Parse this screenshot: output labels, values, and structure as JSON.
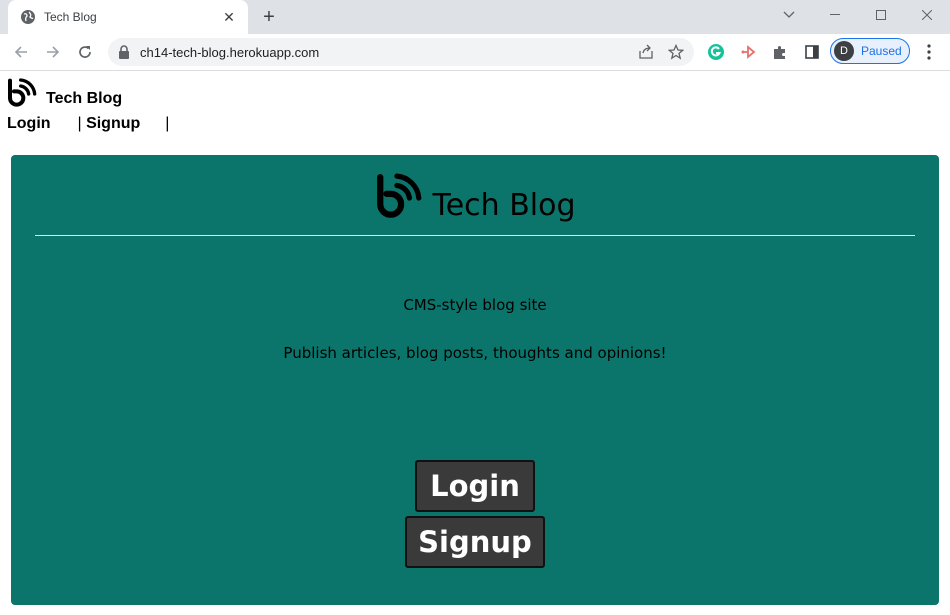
{
  "browser": {
    "tab_title": "Tech Blog",
    "tab_close": "✕",
    "new_tab": "+",
    "url": "ch14-tech-blog.herokuapp.com",
    "profile_initial": "D",
    "profile_status": "Paused",
    "accent_color": "#1a73e8"
  },
  "site": {
    "brand_name": "Tech Blog",
    "nav": {
      "login": "Login",
      "separator": "|",
      "signup": "Signup"
    }
  },
  "hero": {
    "title": "Tech Blog",
    "tagline": "CMS-style blog site",
    "description": "Publish articles, blog posts, thoughts and opinions!",
    "login_button": "Login",
    "signup_button": "Signup",
    "background_color": "#0c756b"
  }
}
